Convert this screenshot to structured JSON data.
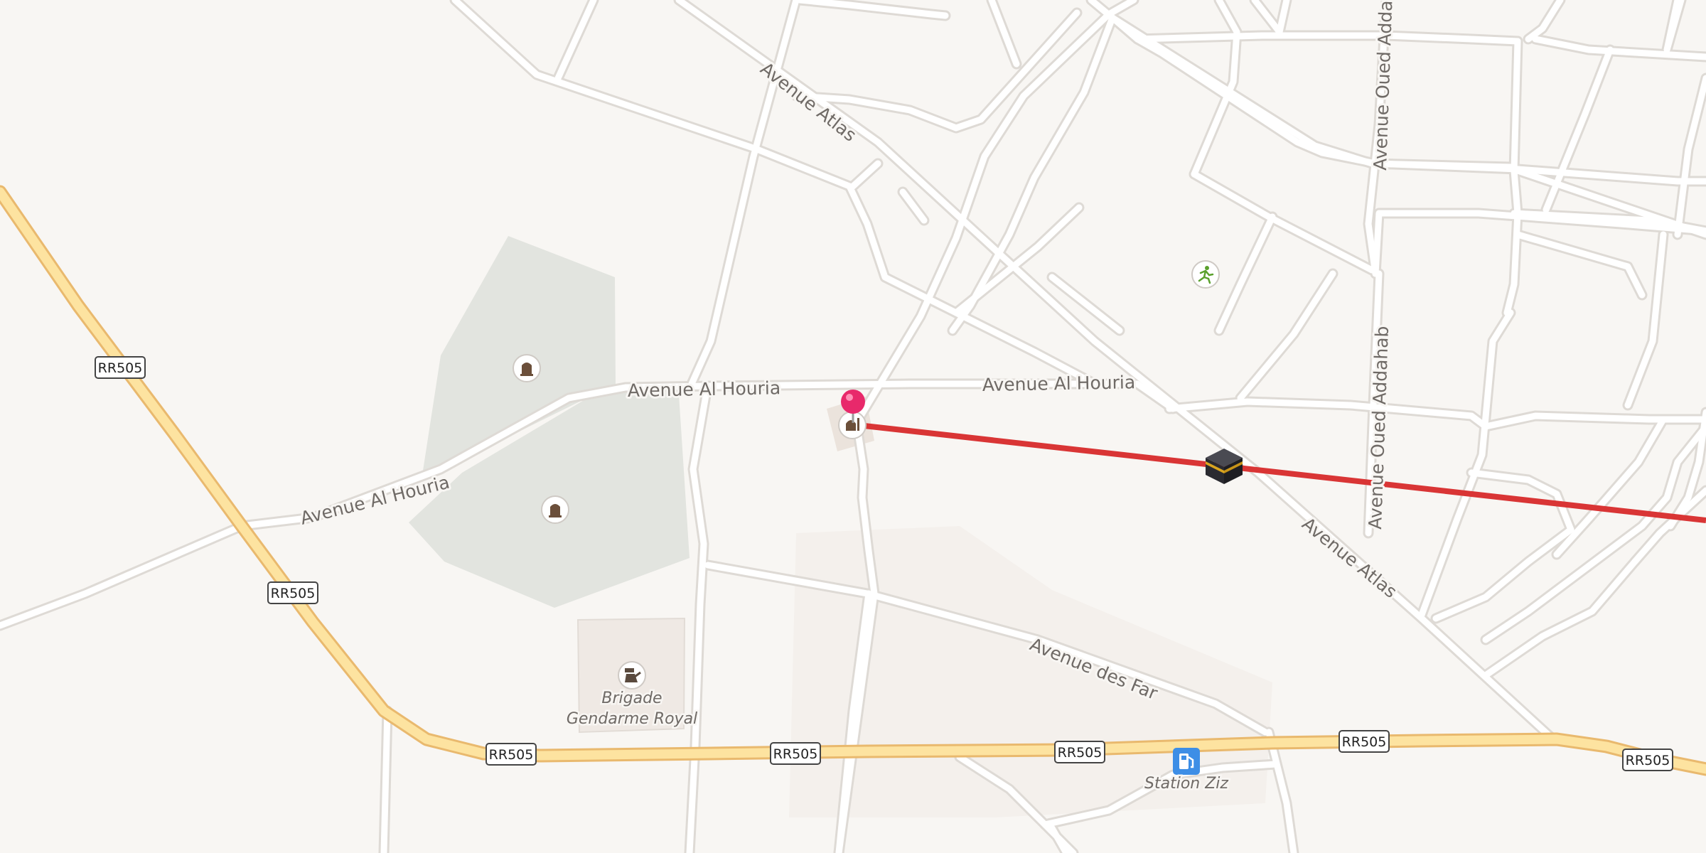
{
  "map": {
    "road_labels": {
      "avenue_atlas_north": "Avenue Atlas",
      "avenue_atlas_south": "Avenue Atlas",
      "avenue_al_houria_center": "Avenue Al Houria",
      "avenue_al_houria_east": "Avenue Al Houria",
      "avenue_al_houria_west": "Avenue Al Houria",
      "avenue_oued_addahab_north": "Avenue Oued Addahab",
      "avenue_oued_addahab_south": "Avenue Oued Addahab",
      "avenue_des_far": "Avenue des Far"
    },
    "route_shield": "RR505",
    "pois": {
      "gendarmerie": "Brigade Gendarme Royal",
      "gendarmerie_line1": "Brigade",
      "gendarmerie_line2": "Gendarme Royal",
      "fuel_station": "Station Ziz"
    },
    "icons": [
      "cemetery-icon",
      "cemetery-icon",
      "mosque-icon",
      "sports-icon",
      "police-icon",
      "fuel-icon",
      "kaaba-icon",
      "location-pin-icon"
    ],
    "colors": {
      "background": "#f8f6f3",
      "road": "#ffffff",
      "road_casing": "#dedad5",
      "primary_road": "#fde3a0",
      "primary_casing": "#e9b96e",
      "cemetery_area": "#e2e4df",
      "qibla_line": "#d93535",
      "pin": "#e8296b",
      "fuel": "#3d8ee6"
    }
  }
}
